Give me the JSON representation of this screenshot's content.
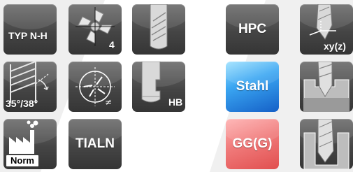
{
  "tiles": {
    "typ_nh": "TYP N-H",
    "flutes_count": "4",
    "helix_angle": "35°/38°",
    "hb": "HB",
    "norm": "Norm",
    "tialn": "TIALN",
    "hpc": "HPC",
    "stahl": "Stahl",
    "gg": "GG(G)",
    "xyz": "xy(z)"
  },
  "colors": {
    "tile_dark": "#454545",
    "stahl_blue": "#3aa6f2",
    "gg_red": "#f07a7a",
    "background_shape": "#ebebeb"
  }
}
